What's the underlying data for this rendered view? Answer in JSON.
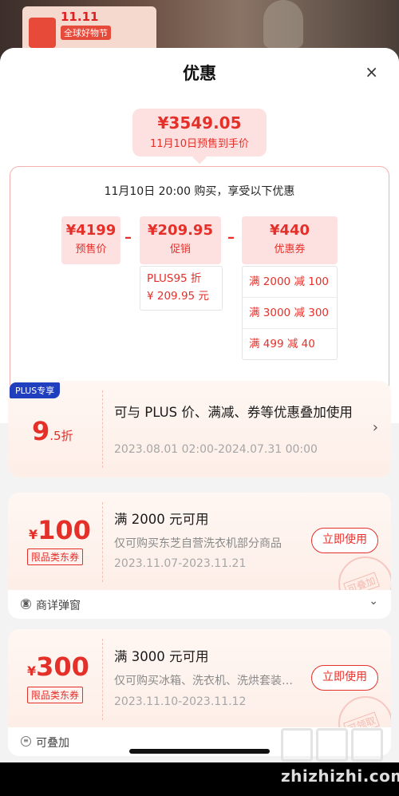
{
  "background": {
    "banner_title": "11.11",
    "banner_subtitle": "全球好物节"
  },
  "sheet": {
    "title": "优惠",
    "close": "×"
  },
  "final_price": {
    "amount": "¥3549.05",
    "desc": "11月10日预售到手价"
  },
  "calculation": {
    "caption": "11月10日 20:00 购买，享受以下优惠",
    "items": [
      {
        "amount": "¥4199",
        "label": "预售价"
      },
      {
        "amount": "¥209.95",
        "label": "促销"
      },
      {
        "amount": "¥440",
        "label": "优惠券"
      }
    ],
    "operators": [
      "–",
      "–"
    ],
    "promo_details": [
      "PLUS95 折",
      "¥ 209.95 元"
    ],
    "coupon_details": [
      "满 2000 减 100",
      "满 3000 减 300",
      "满 499 减 40"
    ]
  },
  "coupons": [
    {
      "tag": "PLUS专享",
      "value_big": "9",
      "value_small": ".5折",
      "title": "可与 PLUS 价、满减、券等优惠叠加使用",
      "date": "2023.08.01 02:00-2024.07.31 00:00",
      "chevron": "›"
    },
    {
      "yen": "¥",
      "amount": "100",
      "category": "限品类东券",
      "title": "满 2000 元可用",
      "sub": "仅可购买东芝自营洗衣机部分商品",
      "date": "2023.11.07-2023.11.21",
      "button": "立即使用",
      "stamp": "可叠加",
      "footer": "商详弹窗",
      "footer_icon": "◙",
      "footer_chevron": "⌄"
    },
    {
      "yen": "¥",
      "amount": "300",
      "category": "限品类东券",
      "title": "满 3000 元可用",
      "sub": "仅可购买冰箱、洗衣机、洗烘套装部分商品",
      "date": "2023.11.10-2023.11.12",
      "button": "立即使用",
      "stamp": "可领取",
      "footer": "可叠加",
      "footer_icon": "≡"
    }
  ],
  "watermark": {
    "text": "zhizhizhi.com"
  },
  "colors": {
    "accent": "#e5302a",
    "pill_bg": "#fde1e1",
    "plus_blue": "#1f3fbf"
  }
}
